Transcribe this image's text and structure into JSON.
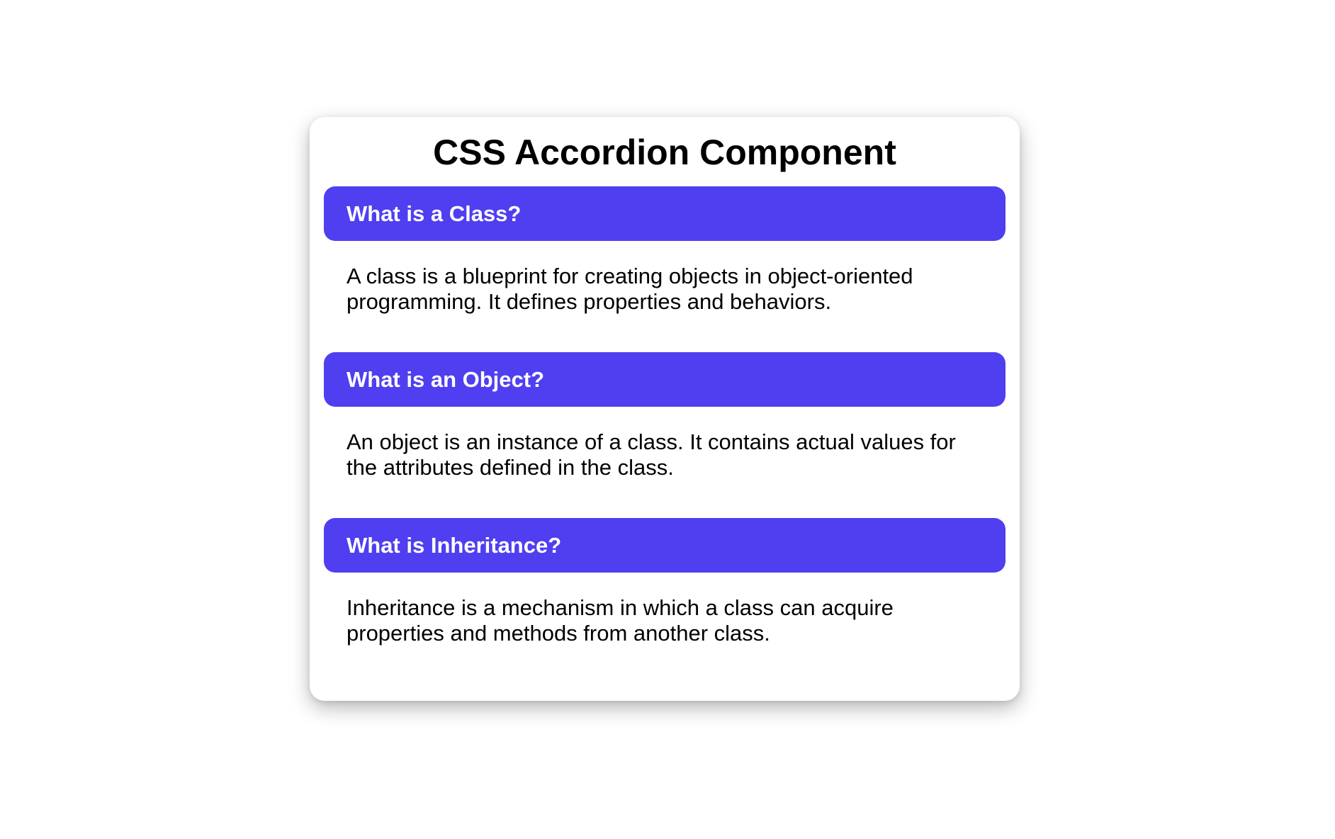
{
  "page": {
    "title": "CSS Accordion Component"
  },
  "accordion": {
    "items": [
      {
        "question": "What is a Class?",
        "answer": "A class is a blueprint for creating objects in object-oriented programming. It defines properties and behaviors."
      },
      {
        "question": "What is an Object?",
        "answer": "An object is an instance of a class. It contains actual values for the attributes defined in the class."
      },
      {
        "question": "What is Inheritance?",
        "answer": "Inheritance is a mechanism in which a class can acquire properties and methods from another class."
      }
    ]
  },
  "colors": {
    "accent": "#4f3ff0",
    "header_text": "#ffffff",
    "body_text": "#000000",
    "background": "#ffffff"
  }
}
